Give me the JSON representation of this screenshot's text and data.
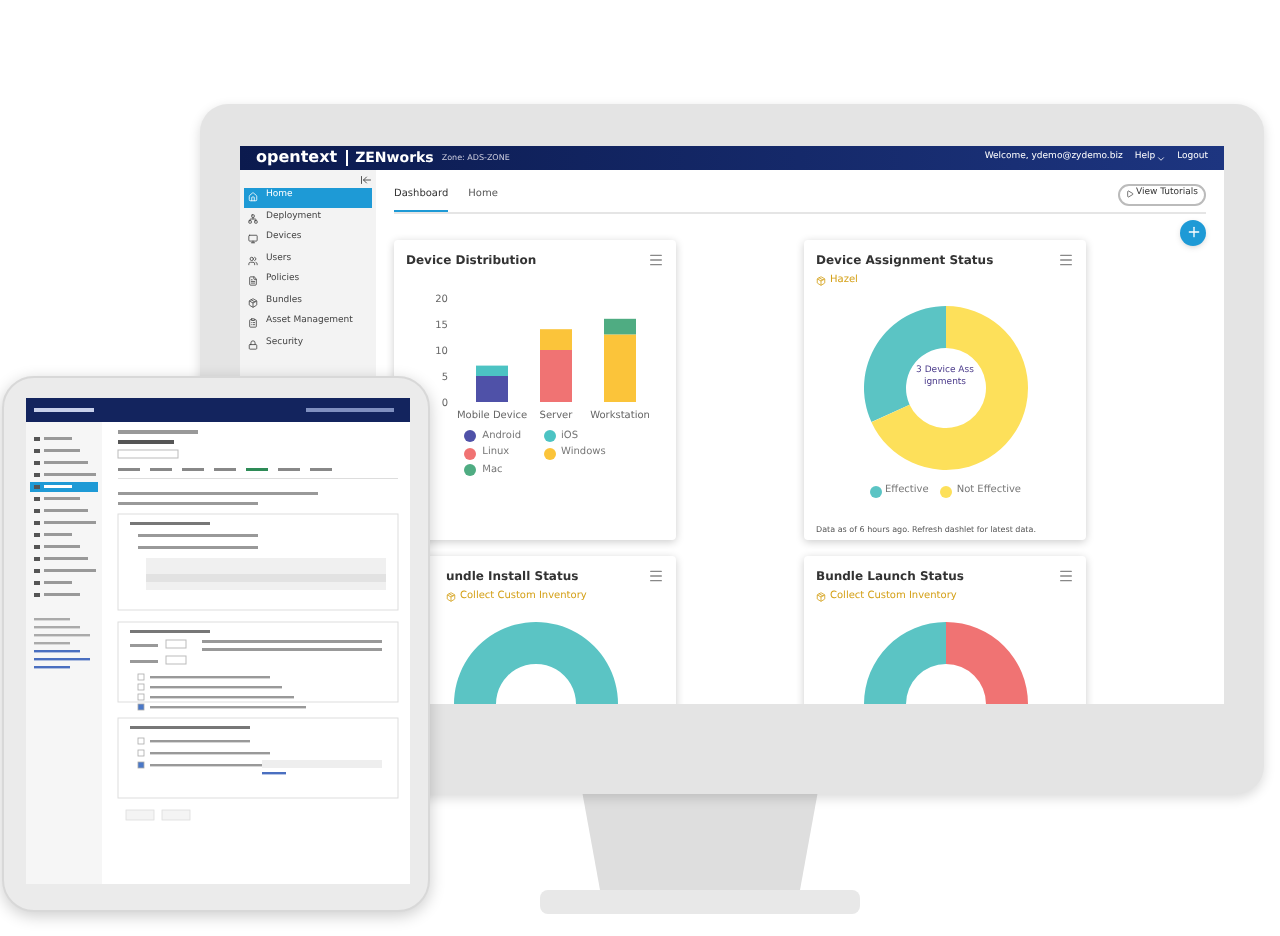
{
  "header": {
    "brand": "opentext",
    "product": "ZENworks",
    "zone": "Zone: ADS-ZONE",
    "welcome": "Welcome, ydemo@zydemo.biz",
    "help": "Help",
    "logout": "Logout"
  },
  "sidebar": {
    "items": [
      {
        "label": "Home",
        "selected": true
      },
      {
        "label": "Deployment",
        "selected": false
      },
      {
        "label": "Devices",
        "selected": false
      },
      {
        "label": "Users",
        "selected": false
      },
      {
        "label": "Policies",
        "selected": false
      },
      {
        "label": "Bundles",
        "selected": false
      },
      {
        "label": "Asset Management",
        "selected": false
      },
      {
        "label": "Security",
        "selected": false
      }
    ]
  },
  "tabs": [
    {
      "label": "Dashboard",
      "selected": true
    },
    {
      "label": "Home",
      "selected": false
    }
  ],
  "tutorials_button": "View Tutorials",
  "dashlets": [
    {
      "kind": "bar",
      "title": "Device Distribution",
      "chart_data": {
        "type": "bar",
        "stacked": true,
        "categories": [
          "Mobile Device",
          "Server",
          "Workstation"
        ],
        "yticks": [
          0,
          5,
          10,
          15,
          20
        ],
        "ylim": [
          0,
          20
        ],
        "series": [
          {
            "name": "Android",
            "color": "#4f51a8",
            "values": [
              5,
              0,
              0
            ]
          },
          {
            "name": "iOS",
            "color": "#4cc3c3",
            "values": [
              2,
              0,
              0
            ]
          },
          {
            "name": "Linux",
            "color": "#f07373",
            "values": [
              0,
              10,
              0
            ]
          },
          {
            "name": "Windows",
            "color": "#fbc43a",
            "values": [
              0,
              4,
              13
            ]
          },
          {
            "name": "Mac",
            "color": "#4fac82",
            "values": [
              0,
              0,
              3
            ]
          }
        ]
      }
    },
    {
      "kind": "donut",
      "title": "Device Assignment Status",
      "subtitle": "Hazel",
      "center_text": "3 Device Assignments",
      "legend": [
        {
          "label": "Effective",
          "color": "#5bc4c4"
        },
        {
          "label": "Not Effective",
          "color": "#fde05a"
        }
      ],
      "footnote": "Data as of 6 hours ago. Refresh dashlet for latest data."
    },
    {
      "kind": "donut",
      "title": "undle Install Status",
      "subtitle": "Collect Custom Inventory"
    },
    {
      "kind": "donut",
      "title": "Bundle Launch Status",
      "subtitle": "Collect Custom Inventory"
    }
  ]
}
